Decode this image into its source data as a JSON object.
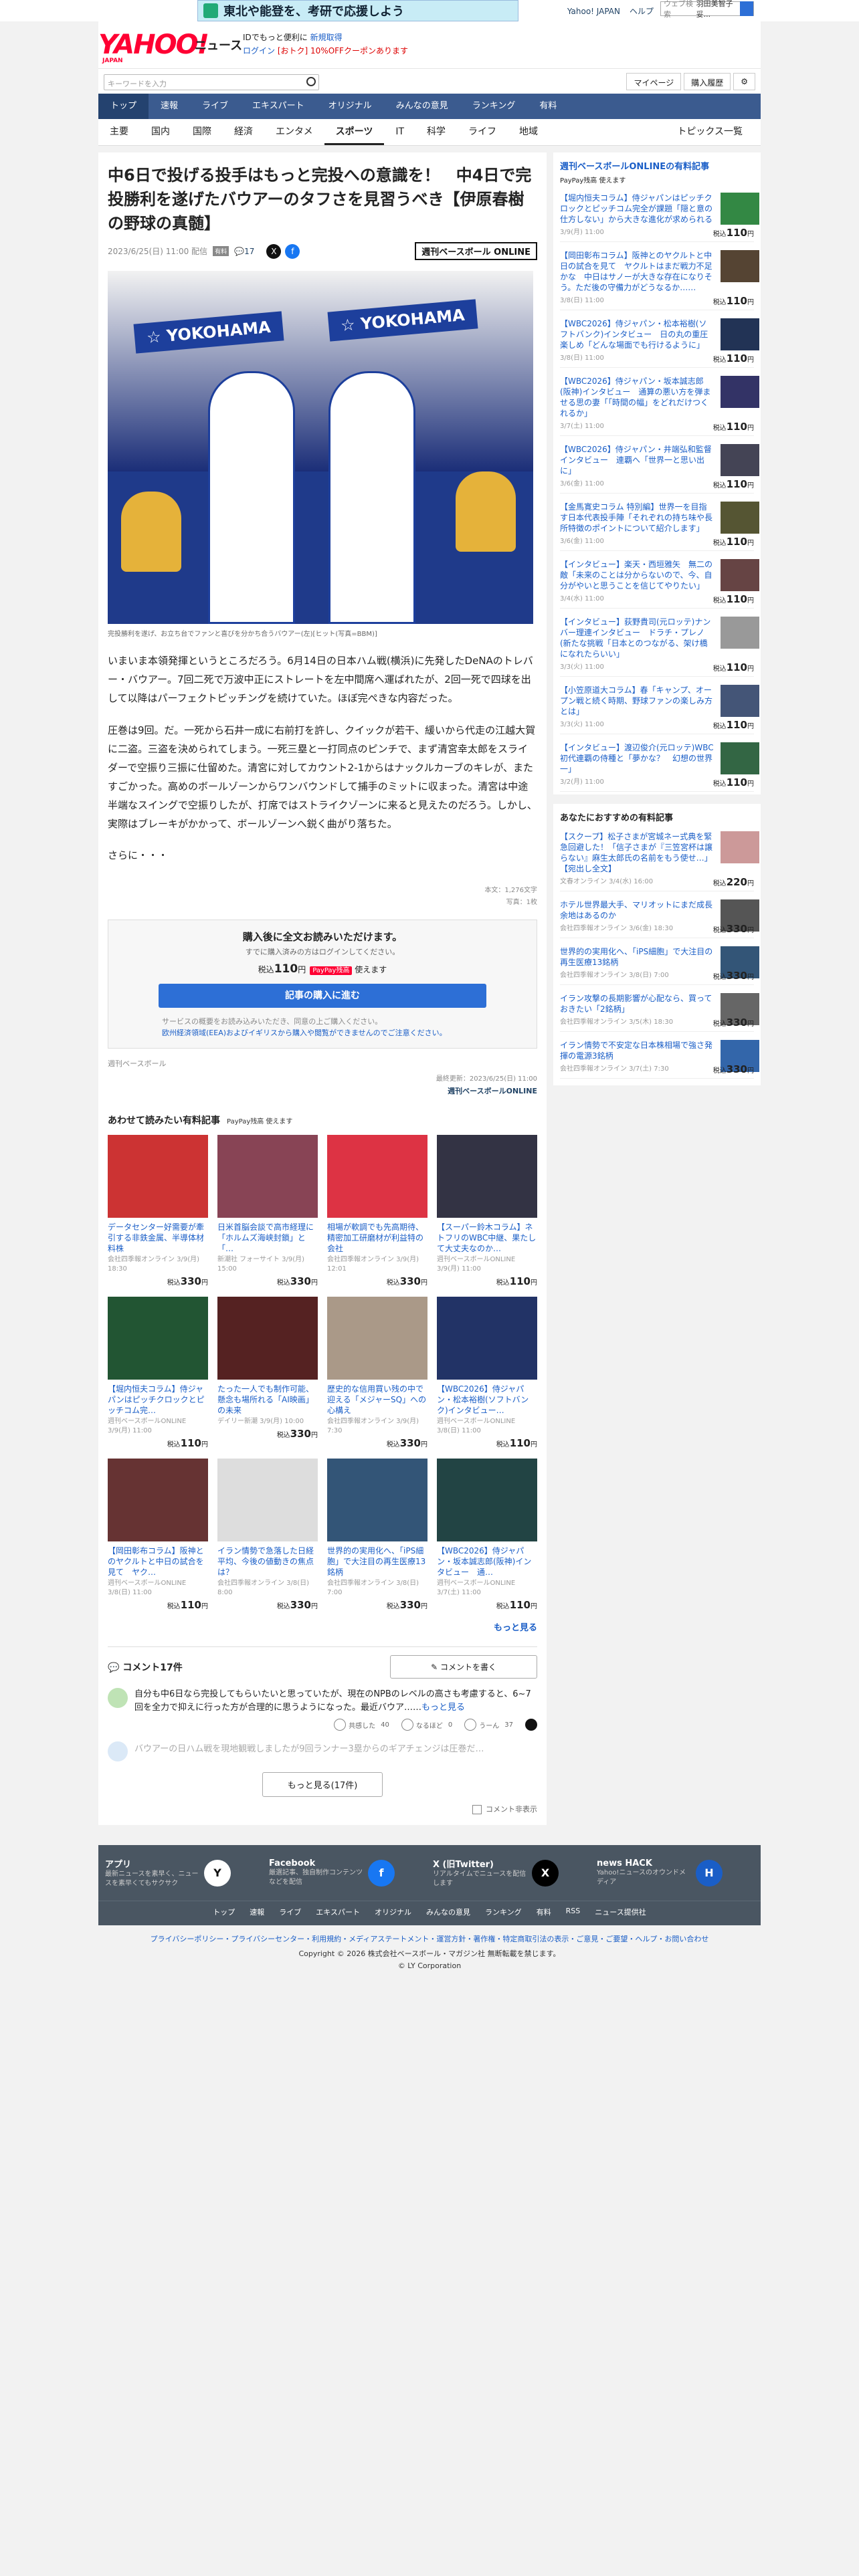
{
  "topbar": {
    "banner": "東北や能登を、考研で応援しよう",
    "links": [
      "Yahoo! JAPAN",
      "ヘルプ"
    ],
    "search_placeholder": "ウェブ検索",
    "search_right": "羽田美智子 妥..."
  },
  "header": {
    "logo": "YAHOO!",
    "logo_sub": "JAPAN",
    "news": "ニュース",
    "promo1": "IDでもっと便利に",
    "promo1b": "新規取得",
    "promo2": "ログイン",
    "promo3": "[おトク] 10%OFFクーポンあります"
  },
  "search": {
    "placeholder": "キーワードを入力",
    "mypage": "マイページ",
    "history": "購入履歴"
  },
  "nav": [
    "トップ",
    "速報",
    "ライブ",
    "エキスパート",
    "オリジナル",
    "みんなの意見",
    "ランキング",
    "有料"
  ],
  "subnav": [
    "主要",
    "国内",
    "国際",
    "経済",
    "エンタメ",
    "スポーツ",
    "IT",
    "科学",
    "ライフ",
    "地域"
  ],
  "subnav_right": "トピックス一覧",
  "article": {
    "title": "中6日で投げる投手はもっと完投への意識を！　中4日で完投勝利を遂げたバウアーのタフさを見習うべき【伊原春樹の野球の真髄】",
    "date": "2023/6/25(日) 11:00 配信",
    "badge": "有料",
    "comments": "17",
    "publisher_logo": "週刊ベースボール ONLINE",
    "photo_banner": "☆ YOKOHAMA",
    "caption": "完投勝利を遂げ、お立ち台でファンと喜びを分かち合うバウアー(左)[ヒット(写真=BBM)]",
    "p1": "いまいま本領発揮というところだろう。6月14日の日本ハム戦(横浜)に先発したDeNAのトレバー・バウアー。7回二死で万波中正にストレートを左中間席へ運ばれたが、2回一死で四球を出して以降はパーフェクトピッチングを続けていた。ほぼ完ぺきな内容だった。",
    "p2": "圧巻は9回。だ。一死から石井一成に右前打を許し、クイックが若干、緩いから代走の江越大賀に二盗。三盗を決められてしまう。一死三塁と一打同点のピンチで、まず清宮幸太郎をスライダーで空振り三振に仕留めた。清宮に対してカウント2-1からはナックルカーブのキレが、またすごかった。高めのボールゾーンからワンバウンドして捕手のミットに収まった。清宮は中途半端なスイングで空振りしたが、打席ではストライクゾーンに来ると見えたのだろう。しかし、実際はブレーキがかかって、ボールゾーンへ鋭く曲がり落ちた。",
    "more": "さらに・・・",
    "stats1": "本文：1,276文字",
    "stats2": "写真：1枚",
    "pay_h": "購入後に全文お読みいただけます。",
    "pay_s": "すでに購入済みの方はログインしてください。",
    "pay_price_pre": "税込",
    "pay_price": "110",
    "pay_price_unit": "円",
    "pay_pp": "PayPay残高",
    "pay_pp_tail": "使えます",
    "pay_btn": "記事の購入に進む",
    "pay_note1": "サービスの概要をお読み込みいただき、同意の上ご購入ください。",
    "pay_note2": "欧州経済領域(EEA)およびイギリスから購入や閲覧ができませんのでご注意ください。",
    "pubname": "週刊ベースボール",
    "updated": "最終更新：2023/6/25(日) 11:00",
    "pub2": "週刊ベースボールONLINE"
  },
  "related": {
    "title": "あわせて読みたい有料記事",
    "pp": "PayPay残高 使えます",
    "items": [
      {
        "t": "データセンター好需要が牽引する非鉄金属、半導体材料株",
        "m": "会社四季報オンライン 3/9(月) 18:30",
        "p": "330"
      },
      {
        "t": "日米首脳会談で高市経理に「ホルムズ海峡封鎖」と「…",
        "m": "新潮社 フォーサイト 3/9(月) 15:00",
        "p": "330"
      },
      {
        "t": "相場が軟調でも先高期待、精密加工研磨材が利益特の会社",
        "m": "会社四季報オンライン 3/9(月) 12:01",
        "p": "330"
      },
      {
        "t": "【スーパー鈴木コラム】ネトフリのWBC中継、果たして大丈夫なのか…",
        "m": "週刊ベースボールONLINE 3/9(月) 11:00",
        "p": "110"
      },
      {
        "t": "【堀内恒夫コラム】侍ジャパンはピッチクロックとピッチコム完…",
        "m": "週刊ベースボールONLINE 3/9(月) 11:00",
        "p": "110"
      },
      {
        "t": "たった一人でも制作可能、懸念も場所れる「AI映画」の未来",
        "m": "デイリー新潮 3/9(月) 10:00",
        "p": "330"
      },
      {
        "t": "歴史的な信用買い残の中で迎える「メジャーSQ」への心構え",
        "m": "会社四季報オンライン 3/9(月) 7:30",
        "p": "330"
      },
      {
        "t": "【WBC2026】侍ジャパン・松本裕樹(ソフトバンク)インタビュー…",
        "m": "週刊ベースボールONLINE 3/8(日) 11:00",
        "p": "110"
      },
      {
        "t": "【岡田彰布コラム】阪神とのヤクルトと中日の試合を見て　ヤク…",
        "m": "週刊ベースボールONLINE 3/8(日) 11:00",
        "p": "110"
      },
      {
        "t": "イラン情勢で急落した日経平均、今後の値動きの焦点は？",
        "m": "会社四季報オンライン 3/8(日) 8:00",
        "p": "330"
      },
      {
        "t": "世界的の実用化へ、「iPS細胞」で大注目の再生医療13銘柄",
        "m": "会社四季報オンライン 3/8(日) 7:00",
        "p": "330"
      },
      {
        "t": "【WBC2026】侍ジャパン・坂本誠志郎(阪神)インタビュー　通…",
        "m": "週刊ベースボールONLINE 3/7(土) 11:00",
        "p": "110"
      }
    ],
    "more": "もっと見る"
  },
  "comments": {
    "title": "コメント17件",
    "write": "コメントを書く",
    "c1": "自分も中6日なら完投してもらいたいと思っていたが、現在のNPBのレベルの高さも考慮すると、6~7回を全力で抑えに行った方が合理的に思うようになった。最近バウア……",
    "c1_more": "もっと見る",
    "r1": "共感した",
    "r1n": "40",
    "r2": "なるほど",
    "r2n": "0",
    "r3": "うーん",
    "r3n": "37",
    "c2": "バウアーの日ハム戦を現地観戦しましたが9回ランナー3塁からのギアチェンジは圧巻だ…",
    "more": "もっと見る(17件)",
    "hide": "コメント非表示"
  },
  "side": {
    "title": "週刊ベースボールONLINEの有料記事",
    "pp": "PayPay残高 使えます",
    "items": [
      {
        "t": "【堀内恒夫コラム】侍ジャパンはピッチクロックとピッチコム完全が課題「隠と意の仕方しない」から大きな進化が求められる",
        "d": "3/9(月) 11:00",
        "p": "110"
      },
      {
        "t": "【岡田彰布コラム】阪神とのヤクルトと中日の試合を見て　ヤクルトはまだ戦力不足かな　中日はサノーが大きな存在になりそう。ただ後の守備力がどうなるか……",
        "d": "3/8(日) 11:00",
        "p": "110"
      },
      {
        "t": "【WBC2026】侍ジャパン・松本裕樹(ソフトバンク)インタビュー　日の丸の重圧楽しめ「どんな場面でも行けるように」",
        "d": "3/8(日) 11:00",
        "p": "110"
      },
      {
        "t": "【WBC2026】侍ジャパン・坂本誠志郎(阪神)インタビュー　通算の悪い方を弾ませる思の妻「「時間の幅」をどれだけつくれるか」",
        "d": "3/7(土) 11:00",
        "p": "110"
      },
      {
        "t": "【WBC2026】侍ジャパン・井端弘和監督インタビュー　連覇へ「世界一と思い出に」",
        "d": "3/6(金) 11:00",
        "p": "110"
      },
      {
        "t": "【金馬寛史コラム 特別編】世界一を目指す日本代表投手陣「それぞれの持ち味や長所特徴のポイントについて紹介します」",
        "d": "3/6(金) 11:00",
        "p": "110"
      },
      {
        "t": "【インタビュー】楽天・西垣雅矢　無二の敵「未来のことは分からないので、今、自分がやいと思うことを信じてやりたい」",
        "d": "3/4(水) 11:00",
        "p": "110"
      },
      {
        "t": "【インタビュー】荻野貴司(元ロッテ)ナンバー理連インタビュー　ドラチ・プレノ(新たな挑戦「日本とのつながる、架け橋になれたらいい」",
        "d": "3/3(火) 11:00",
        "p": "110"
      },
      {
        "t": "【小笠原道大コラム】春「キャンプ、オープン戦と続く時期、野球ファンの楽しみ方とは」",
        "d": "3/3(火) 11:00",
        "p": "110"
      },
      {
        "t": "【インタビュー】渡辺俊介(元ロッテ)WBC初代連覇の侍種と「夢かな？　幻想の世界一」",
        "d": "3/2(月) 11:00",
        "p": "110"
      }
    ],
    "title2": "あなたにおすすめの有料記事",
    "items2": [
      {
        "t": "【スクープ】松子さまが宮城ネー式典を緊急回避した！「信子さまが『三笠宮杯は譲らない』麻生太郎氏の名前をもう使せ…」【宛出し全文】",
        "d": "文春オンライン 3/4(水) 16:00",
        "p": "220"
      },
      {
        "t": "ホテル世界最大手、マリオットにまだ成長余地はあるのか",
        "d": "会社四季報オンライン 3/6(金) 18:30",
        "p": "330"
      },
      {
        "t": "世界的の実用化へ、「iPS細胞」で大注目の再生医療13銘柄",
        "d": "会社四季報オンライン 3/8(日) 7:00",
        "p": "330"
      },
      {
        "t": "イラン攻撃の長期影響が心配なら、買っておきたい「2銘柄」",
        "d": "会社四季報オンライン 3/5(木) 18:30",
        "p": "330"
      },
      {
        "t": "イラン情勢で不安定な日本株相場で強さ発揮の電源3銘柄",
        "d": "会社四季報オンライン 3/7(土) 7:30",
        "p": "330"
      }
    ]
  },
  "footer": {
    "cards": [
      {
        "h": "アプリ",
        "d": "最新ニュースを素早く、ニュースを素早くてもサクサク",
        "i": "Y"
      },
      {
        "h": "Facebook",
        "d": "厳選記事、独自制作コンテンツなどを配信",
        "i": "f"
      },
      {
        "h": "X (旧Twitter)",
        "d": "リアルタイムでニュースを配信します",
        "i": "X"
      },
      {
        "h": "news HACK",
        "d": "Yahoo!ニュースのオウンドメディア",
        "i": "H"
      }
    ],
    "nav": [
      "トップ",
      "速報",
      "ライブ",
      "エキスパート",
      "オリジナル",
      "みんなの意見",
      "ランキング",
      "有料",
      "RSS",
      "ニュース提供社"
    ],
    "links": "プライバシーポリシー・プライバシーセンター・利用規約・メディアステートメント・運営方針・著作権・特定商取引法の表示・ご意見・ご要望・ヘルプ・お問い合わせ",
    "copy1": "Copyright © 2026 株式会社ベースボール・マガジン社 無断転載を禁じます。",
    "copy2": "© LY Corporation"
  }
}
